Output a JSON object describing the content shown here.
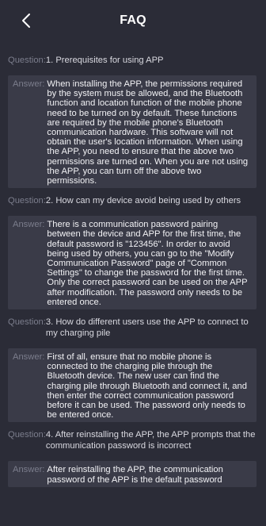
{
  "header": {
    "title": "FAQ",
    "back_icon": "chevron-left-icon"
  },
  "labels": {
    "question": "Question:",
    "answer": "Answer:"
  },
  "faq": [
    {
      "question": "1. Prerequisites for using APP",
      "answer": "When installing the APP, the permissions required by the system must be allowed, and the Bluetooth function and location function of the mobile phone need to be turned on by default. These functions are required by the mobile phone's Bluetooth communication hardware. This software will not obtain the user's location information. When using the APP, you need to ensure that the above two permissions are turned on. When you are not using the APP, you can turn off the above two permissions."
    },
    {
      "question": "2. How can my device avoid being used by others",
      "answer": "There is a communication password pairing between the device and APP for the first time, the default password is \"123456\". In order to avoid being used by others, you can go to the \"Modify Communication Password\" page of \"Common Settings\" to change the password for the first time. Only the correct password can be used on the APP after modification. The password only needs to be entered once."
    },
    {
      "question": "3. How do different users use the APP to connect to my charging pile",
      "answer": "First of all, ensure that no mobile phone is connected to the charging pile through the Bluetooth device. The new user can find the charging pile through Bluetooth and connect it, and then enter the correct communication password before it can be used. The password only needs to be entered once."
    },
    {
      "question": "4. After reinstalling the APP, the APP prompts that the communication password is incorrect",
      "answer": "After reinstalling the APP, the communication password of the APP is the default password"
    }
  ],
  "colors": {
    "background": "#2b2c37",
    "answer_background": "#3a3b48",
    "label": "#7b7d8c",
    "text": "#f2f2f5"
  }
}
